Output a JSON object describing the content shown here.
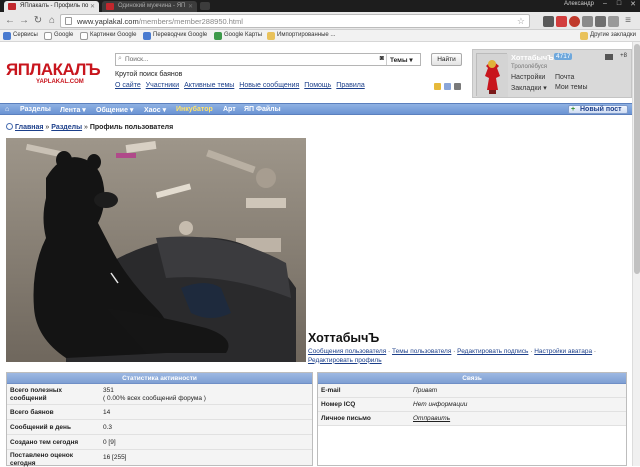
{
  "browser": {
    "tabs": [
      {
        "title": "ЯПлакалъ - Профиль по"
      },
      {
        "title": "Одинокий мужчина - ЯП"
      }
    ],
    "user": "Александр",
    "url_host": "www.yaplakal.com",
    "url_path": "/members/member288950.html",
    "bookmarks": [
      "Сервисы",
      "Google",
      "Картинки Google",
      "Переводчик Google",
      "Google Карты",
      "Импортированные ...",
      "Другие закладки"
    ]
  },
  "site": {
    "logo": "ЯПЛАКАЛЪ",
    "logo_sub": "YAPLAKAL.COM",
    "search_placeholder": "Поиск...",
    "search_scope": "Темы",
    "search_button": "Найти",
    "tagline": "Крутой поиск баянов",
    "top_links": [
      "О сайте",
      "Участники",
      "Активные темы",
      "Новые сообщения",
      "Помощь",
      "Правила"
    ]
  },
  "user_panel": {
    "name": "ХоттабычЪ",
    "karma": "4717",
    "title": "Трололёбуся",
    "pm_count": "+8",
    "links": [
      "Настройки",
      "Почта",
      "Закладки ▾",
      "Мои темы"
    ]
  },
  "nav": {
    "items": [
      {
        "label": "Разделы"
      },
      {
        "label": "Лента ▾"
      },
      {
        "label": "Общение ▾"
      },
      {
        "label": "Хаос ▾"
      },
      {
        "label": "Инкубатор"
      },
      {
        "label": "Арт"
      },
      {
        "label": "ЯП Файлы"
      }
    ],
    "new_post": "Новый пост"
  },
  "breadcrumb": {
    "home": "Главная",
    "sections": "Разделы",
    "current": "Профиль пользователя"
  },
  "profile": {
    "name": "ХоттабычЪ",
    "links": [
      "Сообщения пользователя",
      "Темы пользователя",
      "Редактировать подпись",
      "Настройки аватара",
      "Редактировать профиль"
    ]
  },
  "stats": {
    "title": "Статистика активности",
    "rows": [
      {
        "label": "Всего полезных сообщений",
        "value": "351",
        "sub": "( 0.00% всех сообщений форума )"
      },
      {
        "label": "Всего баянов",
        "value": "14"
      },
      {
        "label": "Сообщений в день",
        "value": "0.3"
      },
      {
        "label": "Создано тем сегодня",
        "value": "0 [9]"
      },
      {
        "label": "Поставлено оценок сегодня",
        "value": "16 [255]"
      }
    ]
  },
  "contact": {
    "title": "Связь",
    "rows": [
      {
        "label": "E-mail",
        "value": "Приват"
      },
      {
        "label": "Номер ICQ",
        "value": "Нет информации"
      },
      {
        "label": "Личное письмо",
        "value": "Отправить"
      }
    ]
  },
  "colors": {
    "brand_red": "#c8151d",
    "nav_blue": "#6b93d3",
    "link_blue": "#1c3f8a"
  }
}
